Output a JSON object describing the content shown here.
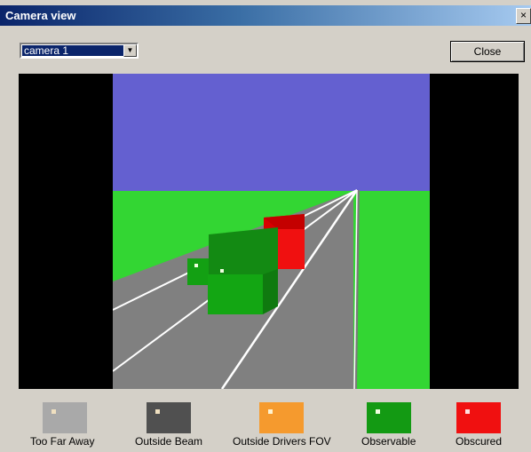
{
  "window": {
    "title": "Camera view",
    "close_glyph": "×"
  },
  "camera_select": {
    "value": "camera 1",
    "arrow_icon": "chevron-down-icon"
  },
  "close_button": {
    "label": "Close"
  },
  "legend": [
    {
      "label": "Too Far Away",
      "color": "#a9a9a9",
      "dot": "#f0e0c0"
    },
    {
      "label": "Outside Beam",
      "color": "#505050",
      "dot": "#f0e0c0"
    },
    {
      "label": "Outside Drivers FOV",
      "color": "#f59a2e",
      "dot": "#fff3d0"
    },
    {
      "label": "Observable",
      "color": "#139a13",
      "dot": "#f0ffe0"
    },
    {
      "label": "Obscured",
      "color": "#f01010",
      "dot": "#ffe0e0"
    }
  ],
  "scene_colors": {
    "sky": "#6460d0",
    "grass": "#33d633",
    "road": "#808080"
  }
}
